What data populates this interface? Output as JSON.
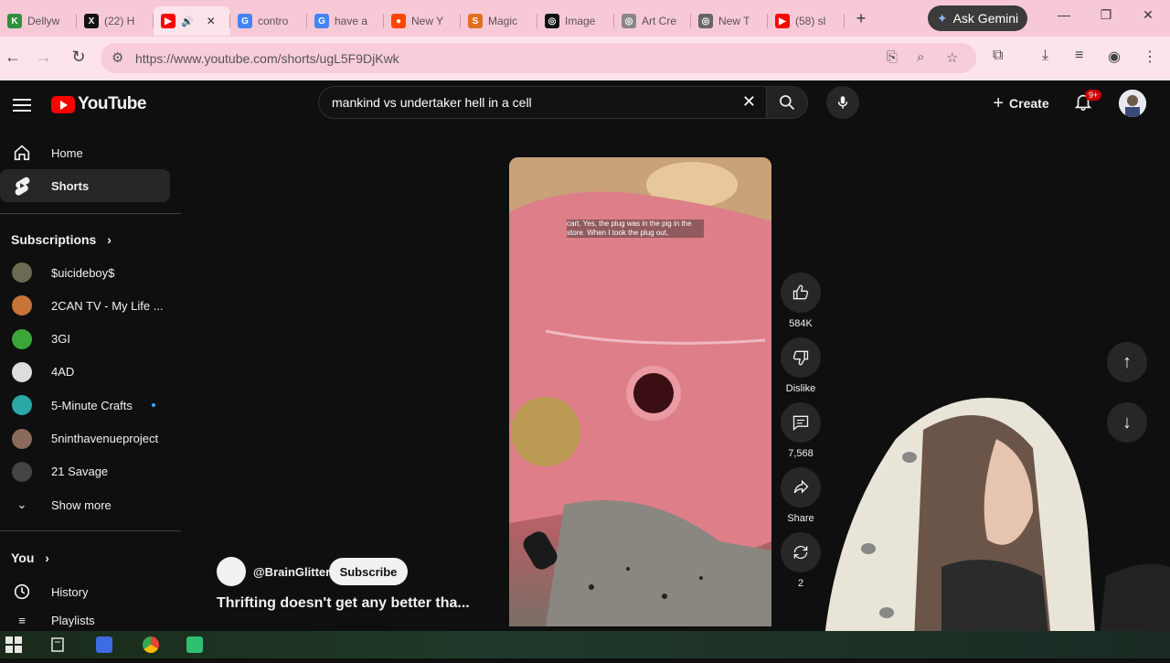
{
  "browser": {
    "tabs": [
      {
        "title": "Dellyw",
        "fav_color": "#2f8f3f",
        "fav_char": "K"
      },
      {
        "title": "(22) H",
        "fav_color": "#111111",
        "fav_char": "X"
      },
      {
        "title": "",
        "fav_color": "#ff0000",
        "fav_char": "▶"
      },
      {
        "title": "contro",
        "fav_color": "#4285f4",
        "fav_char": "G"
      },
      {
        "title": "have a",
        "fav_color": "#4285f4",
        "fav_char": "G"
      },
      {
        "title": "New Y",
        "fav_color": "#ff4500",
        "fav_char": "●"
      },
      {
        "title": "Magic",
        "fav_color": "#e07020",
        "fav_char": "S"
      },
      {
        "title": "Image",
        "fav_color": "#111111",
        "fav_char": "◎"
      },
      {
        "title": "Art Cre",
        "fav_color": "#888888",
        "fav_char": "◎"
      },
      {
        "title": "New T",
        "fav_color": "#666666",
        "fav_char": "◎"
      },
      {
        "title": "(58) sl",
        "fav_color": "#ff0000",
        "fav_char": "▶"
      }
    ],
    "new_tab": "+",
    "gemini_label": "Ask Gemini",
    "url": "https://www.youtube.com/shorts/ugL5F9DjKwk"
  },
  "youtube": {
    "logo_text": "YouTube",
    "search_value": "mankind vs undertaker hell in a cell",
    "create_label": "Create",
    "notif_badge": "9+",
    "sidebar": {
      "main": [
        {
          "label": "Home",
          "icon": "home-icon"
        },
        {
          "label": "Shorts",
          "icon": "shorts-icon"
        }
      ],
      "subscriptions_heading": "Subscriptions",
      "subscriptions": [
        {
          "label": "$uicideboy$",
          "color": "#6b6b52"
        },
        {
          "label": "2CAN TV - My Life ...",
          "color": "#c7733a"
        },
        {
          "label": "3GI",
          "color": "#3aa63a"
        },
        {
          "label": "4AD",
          "color": "#dddddd"
        },
        {
          "label": "5-Minute Crafts",
          "color": "#2aa7a7"
        },
        {
          "label": "5ninthavenueproject",
          "color": "#8a6a5a"
        },
        {
          "label": "21 Savage",
          "color": "#444444"
        }
      ],
      "show_more": "Show more",
      "you_heading": "You",
      "you_items": [
        {
          "label": "History"
        },
        {
          "label": "Playlists"
        }
      ]
    },
    "short": {
      "caption": "cart. Yes, the plug was in the pig in the store. When I took the plug out,",
      "channel": "@BrainGlitter",
      "subscribe": "Subscribe",
      "title": "Thrifting doesn't get any better tha...",
      "actions": {
        "like_count": "584K",
        "dislike_label": "Dislike",
        "comment_count": "7,568",
        "share_label": "Share",
        "remix_count": "2"
      }
    }
  }
}
